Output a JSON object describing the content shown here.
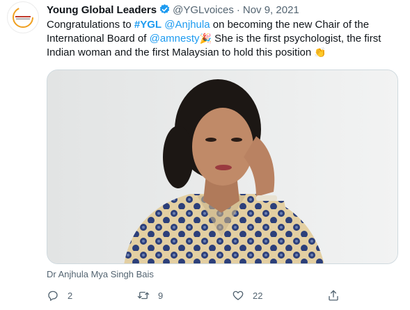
{
  "tweet": {
    "author_name": "Young Global Leaders",
    "handle": "@YGLvoices",
    "separator": "·",
    "date": "Nov 9, 2021",
    "text_parts": {
      "t1": "Congratulations to ",
      "hashtag": "#YGL",
      "t2": " ",
      "mention1": "@Anjhula",
      "t3": " on becoming the new Chair of the International Board of ",
      "mention2": "@amnesty",
      "emoji1": "🎉",
      "t4": " She is the first psychologist, the first Indian woman and the first Malaysian to hold this position ",
      "emoji2": "👏"
    },
    "media_caption": "Dr Anjhula Mya Singh Bais",
    "actions": {
      "reply_count": "2",
      "retweet_count": "9",
      "like_count": "22"
    },
    "icons": {
      "verified": "verified-badge-icon",
      "reply": "reply-icon",
      "retweet": "retweet-icon",
      "like": "heart-icon",
      "share": "share-icon"
    },
    "colors": {
      "link": "#1d9bf0",
      "secondary_text": "#536471",
      "primary_text": "#0f1419"
    }
  }
}
